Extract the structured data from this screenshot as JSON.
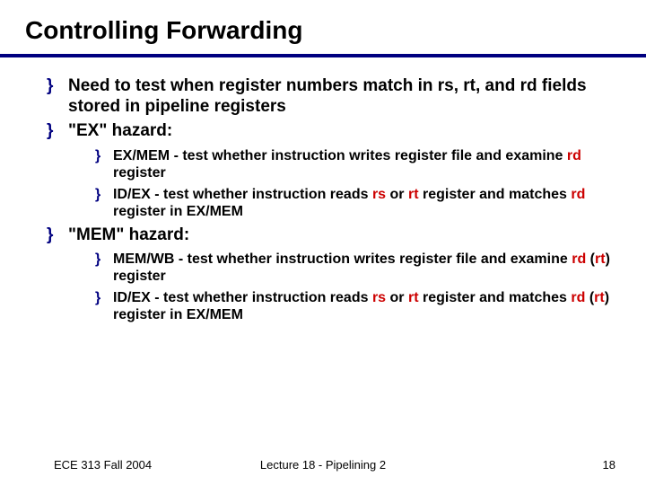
{
  "title": "Controlling Forwarding",
  "bullets": {
    "b1": "Need to test when register numbers match in rs, rt, and rd fields stored in pipeline registers",
    "b2": "\"EX\" hazard:",
    "b2a_pre": "EX/MEM - test whether instruction writes register file and examine ",
    "b2a_rd": "rd",
    "b2a_post": " register",
    "b2b_pre": "ID/EX - test whether instruction reads ",
    "b2b_rs": "rs",
    "b2b_mid1": " or ",
    "b2b_rt": "rt",
    "b2b_mid2": " register and matches ",
    "b2b_rd": "rd",
    "b2b_post": " register in EX/MEM",
    "b3": "\"MEM\" hazard:",
    "b3a_pre": "MEM/WB - test whether instruction writes register file and examine ",
    "b3a_rd": "rd",
    "b3a_mid": " (",
    "b3a_rt": "rt",
    "b3a_post": ") register",
    "b3b_pre": "ID/EX - test whether instruction reads ",
    "b3b_rs": "rs",
    "b3b_mid1": " or ",
    "b3b_rt": "rt",
    "b3b_mid2": " register and matches ",
    "b3b_rd": "rd",
    "b3b_mid3": " (",
    "b3b_rt2": "rt",
    "b3b_post": ") register in EX/MEM"
  },
  "footer": {
    "left": "ECE 313 Fall 2004",
    "center": "Lecture 18 - Pipelining 2",
    "right": "18"
  }
}
